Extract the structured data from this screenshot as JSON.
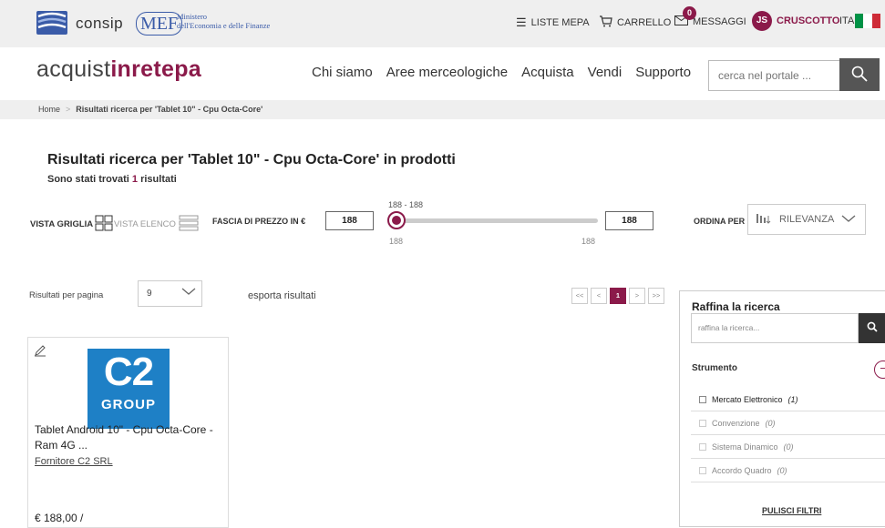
{
  "topbar": {
    "consip_label": "consip",
    "mef_label": "MEF",
    "mef_line1": "Ministero",
    "mef_line2": "dell'Economia e delle Finanze",
    "liste_mepa": "LISTE MEPA",
    "carrello": "CARRELLO",
    "messaggi": "MESSAGGI",
    "messaggi_count": "0",
    "user_initials": "JS",
    "cruscotto": "CRUSCOTTO",
    "language": "ITA",
    "flag_colors": [
      "#009246",
      "#ffffff",
      "#ce2b37"
    ]
  },
  "header": {
    "brand_part1": "acquist",
    "brand_part2": "inrete",
    "brand_part3": "pa",
    "nav": [
      "Chi siamo",
      "Aree merceologiche",
      "Acquista",
      "Vendi",
      "Supporto"
    ],
    "search_placeholder": "cerca nel portale ..."
  },
  "breadcrumb": {
    "home": "Home",
    "current": "Risultati ricerca per 'Tablet 10\" - Cpu Octa-Core'"
  },
  "results": {
    "title": "Risultati ricerca per 'Tablet 10\" - Cpu Octa-Core' in prodotti",
    "count_prefix": "Sono stati trovati",
    "count": "1",
    "count_suffix": "risultati"
  },
  "filters": {
    "vista_griglia": "VISTA GRIGLIA",
    "vista_elenco": "VISTA ELENCO",
    "fascia_label": "FASCIA DI PREZZO IN €",
    "price_min": "188",
    "price_max": "188",
    "range_label": "188 - 188",
    "range_min_label": "188",
    "range_max_label": "188",
    "ordina_label": "ORDINA PER",
    "ordina_value": "RILEVANZA"
  },
  "pagination": {
    "per_page_label": "Risultati per pagina",
    "per_page_value": "9",
    "esporta": "esporta risultati",
    "first": "<<",
    "prev": "<",
    "current": "1",
    "next": ">",
    "last": ">>"
  },
  "product": {
    "logo_big": "C2",
    "logo_small": "GROUP",
    "title_line1": "Tablet Android 10\" - Cpu Octa-Core -",
    "title_line2": "Ram 4G ...",
    "supplier": "Fornitore C2 SRL",
    "price": "€ 188,00 /"
  },
  "refine": {
    "title": "Raffina la ricerca",
    "placeholder": "raffina la ricerca...",
    "strumento_label": "Strumento",
    "collapse_symbol": "−",
    "options": [
      {
        "label": "Mercato Elettronico",
        "count": "(1)",
        "enabled": true
      },
      {
        "label": "Convenzione",
        "count": "(0)",
        "enabled": false
      },
      {
        "label": "Sistema Dinamico",
        "count": "(0)",
        "enabled": false
      },
      {
        "label": "Accordo Quadro",
        "count": "(0)",
        "enabled": false
      }
    ],
    "clear": "PULISCI FILTRI"
  },
  "colors": {
    "accent": "#8b1a4a",
    "logo_blue": "#1e80c6",
    "consip_blue": "#3a5ba8"
  }
}
